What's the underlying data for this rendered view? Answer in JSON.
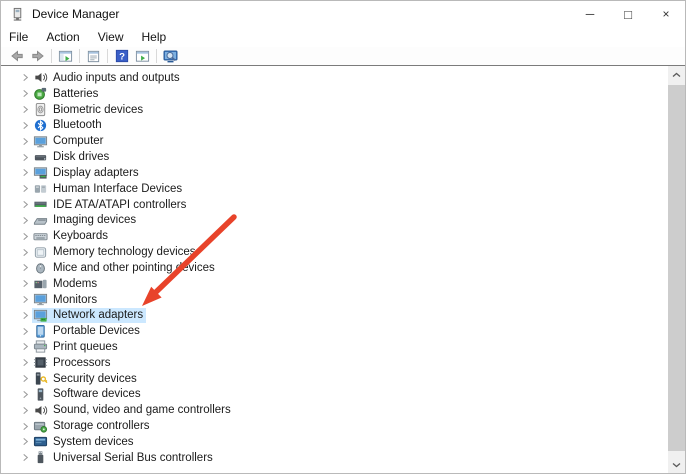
{
  "window": {
    "title": "Device Manager",
    "icon": "device-manager-icon",
    "controls": [
      {
        "name": "minimize",
        "glyph": "─"
      },
      {
        "name": "maximize",
        "glyph": "□"
      },
      {
        "name": "close",
        "glyph": "×"
      }
    ]
  },
  "menu": {
    "items": [
      {
        "label": "File"
      },
      {
        "label": "Action"
      },
      {
        "label": "View"
      },
      {
        "label": "Help"
      }
    ]
  },
  "toolbar": {
    "buttons": [
      {
        "name": "back",
        "icon": "back-arrow-icon"
      },
      {
        "name": "forward",
        "icon": "forward-arrow-icon"
      },
      {
        "name": "show-console-tree",
        "icon": "console-tree-icon"
      },
      {
        "name": "properties",
        "icon": "properties-icon"
      },
      {
        "name": "help",
        "icon": "help-icon"
      },
      {
        "name": "action-pane",
        "icon": "action-pane-icon"
      },
      {
        "name": "scan-hardware-changes",
        "icon": "scan-icon"
      }
    ]
  },
  "tree": {
    "items": [
      {
        "label": "Audio inputs and outputs",
        "icon": "speaker-icon",
        "selected": false
      },
      {
        "label": "Batteries",
        "icon": "battery-icon",
        "selected": false
      },
      {
        "label": "Biometric devices",
        "icon": "fingerprint-icon",
        "selected": false
      },
      {
        "label": "Bluetooth",
        "icon": "bluetooth-icon",
        "selected": false
      },
      {
        "label": "Computer",
        "icon": "computer-icon",
        "selected": false
      },
      {
        "label": "Disk drives",
        "icon": "disk-icon",
        "selected": false
      },
      {
        "label": "Display adapters",
        "icon": "display-adapter-icon",
        "selected": false
      },
      {
        "label": "Human Interface Devices",
        "icon": "hid-icon",
        "selected": false
      },
      {
        "label": "IDE ATA/ATAPI controllers",
        "icon": "ide-controller-icon",
        "selected": false
      },
      {
        "label": "Imaging devices",
        "icon": "imaging-icon",
        "selected": false
      },
      {
        "label": "Keyboards",
        "icon": "keyboard-icon",
        "selected": false
      },
      {
        "label": "Memory technology devices",
        "icon": "memory-card-icon",
        "selected": false
      },
      {
        "label": "Mice and other pointing devices",
        "icon": "mouse-icon",
        "selected": false
      },
      {
        "label": "Modems",
        "icon": "modem-icon",
        "selected": false
      },
      {
        "label": "Monitors",
        "icon": "monitor-icon",
        "selected": false
      },
      {
        "label": "Network adapters",
        "icon": "network-adapter-icon",
        "selected": true
      },
      {
        "label": "Portable Devices",
        "icon": "portable-device-icon",
        "selected": false
      },
      {
        "label": "Print queues",
        "icon": "print-queue-icon",
        "selected": false
      },
      {
        "label": "Processors",
        "icon": "processor-icon",
        "selected": false
      },
      {
        "label": "Security devices",
        "icon": "security-key-icon",
        "selected": false
      },
      {
        "label": "Software devices",
        "icon": "software-device-icon",
        "selected": false
      },
      {
        "label": "Sound, video and game controllers",
        "icon": "speaker-icon",
        "selected": false
      },
      {
        "label": "Storage controllers",
        "icon": "storage-controller-icon",
        "selected": false
      },
      {
        "label": "System devices",
        "icon": "system-device-icon",
        "selected": false
      },
      {
        "label": "Universal Serial Bus controllers",
        "icon": "usb-icon",
        "selected": false
      }
    ]
  },
  "annotation": {
    "type": "arrow",
    "target": "Network adapters",
    "color": "#e8432a"
  },
  "colors": {
    "selection_highlight": "#cce8ff",
    "toolbar_divider": "#7b7b7b",
    "scrollbar_track": "#f0f0f0",
    "scrollbar_thumb": "#cdcdcd",
    "help_button_blue": "#3a5fc8",
    "accent_green": "#3fae49"
  }
}
